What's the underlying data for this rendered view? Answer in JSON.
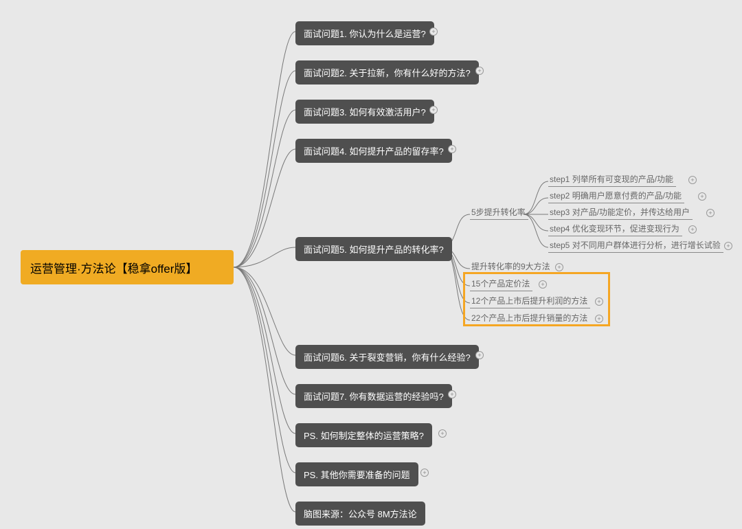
{
  "root": {
    "title": "运营管理·方法论【稳拿offer版】"
  },
  "level1": [
    {
      "label": "面试问题1. 你认为什么是运营?"
    },
    {
      "label": "面试问题2. 关于拉新，你有什么好的方法?"
    },
    {
      "label": "面试问题3. 如何有效激活用户?"
    },
    {
      "label": "面试问题4. 如何提升产品的留存率?"
    },
    {
      "label": "面试问题5. 如何提升产品的转化率?"
    },
    {
      "label": "面试问题6. 关于裂变营销，你有什么经验?"
    },
    {
      "label": "面试问题7. 你有数据运营的经验吗?"
    },
    {
      "label": "PS. 如何制定整体的运营策略?"
    },
    {
      "label": "PS. 其他你需要准备的问题"
    },
    {
      "label": "脑图来源：公众号 8M方法论"
    }
  ],
  "q5_children": [
    {
      "label": "5步提升转化率"
    },
    {
      "label": "提升转化率的9大方法"
    },
    {
      "label": "15个产品定价法"
    },
    {
      "label": "12个产品上市后提升利润的方法"
    },
    {
      "label": "22个产品上市后提升销量的方法"
    }
  ],
  "q5_steps": [
    {
      "label": "step1 列举所有可变现的产品/功能"
    },
    {
      "label": "step2 明确用户愿意付费的产品/功能"
    },
    {
      "label": "step3 对产品/功能定价，并传达给用户"
    },
    {
      "label": "step4 优化变现环节，促进变现行为"
    },
    {
      "label": "step5 对不同用户群体进行分析，进行增长试验"
    }
  ],
  "expand_symbol": "+"
}
